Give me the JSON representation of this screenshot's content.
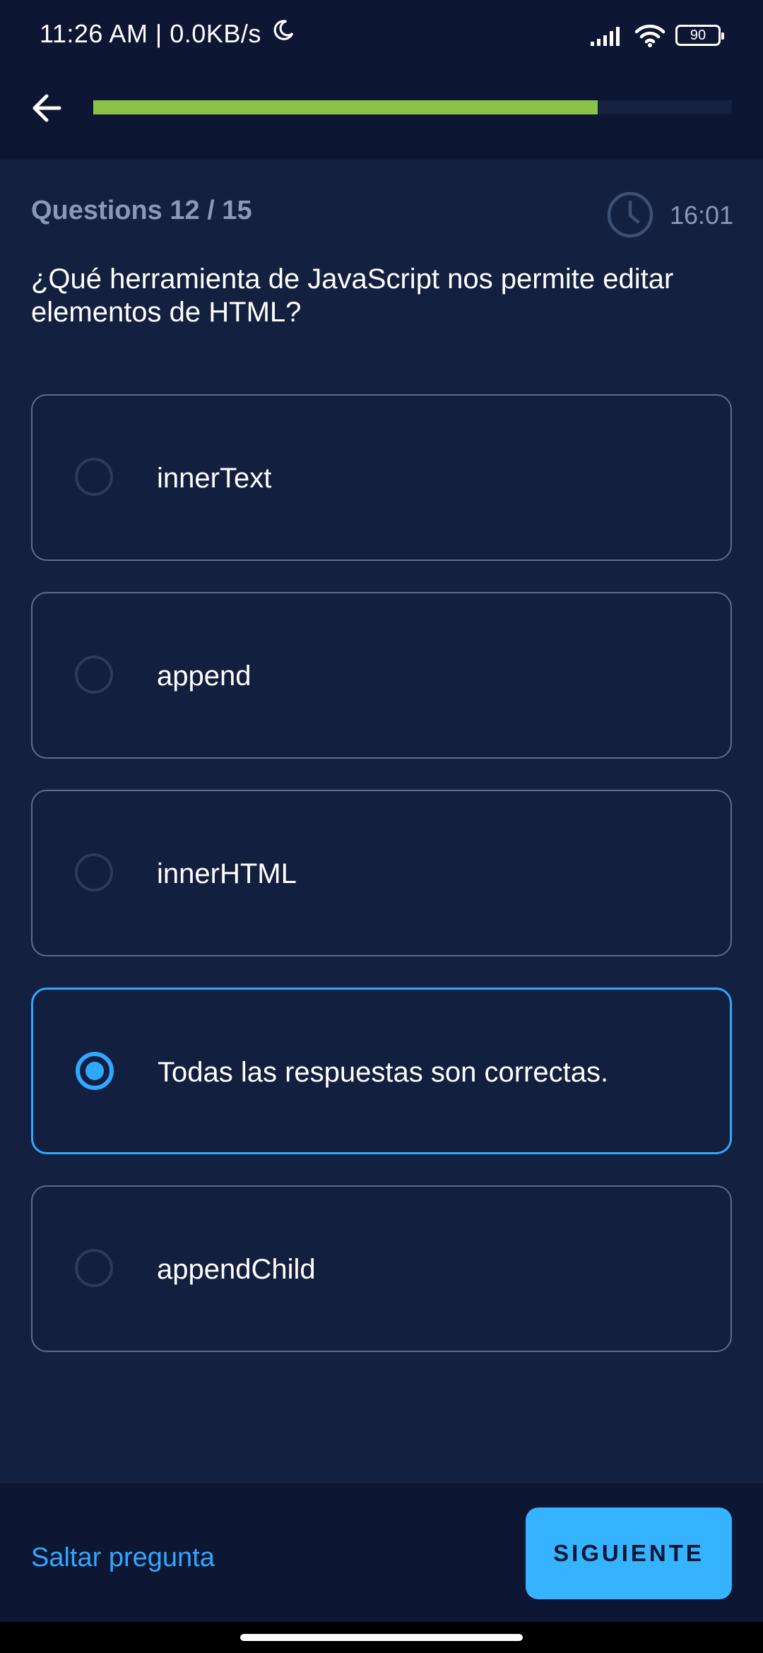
{
  "status_bar": {
    "time": "11:26 AM | 0.0KB/s",
    "battery": "90"
  },
  "progress": {
    "fraction": 0.79
  },
  "quiz": {
    "question_count": "Questions 12 / 15",
    "timer": "16:01",
    "question": "¿Qué herramienta de JavaScript nos permite editar elementos de HTML?",
    "options": [
      {
        "label": "innerText",
        "selected": false
      },
      {
        "label": "append",
        "selected": false
      },
      {
        "label": "innerHTML",
        "selected": false
      },
      {
        "label": "Todas las respuestas son correctas.",
        "selected": true
      },
      {
        "label": "appendChild",
        "selected": false
      }
    ]
  },
  "footer": {
    "skip_label": "Saltar pregunta",
    "next_label": "SIGUIENTE"
  },
  "colors": {
    "background": "#13203f",
    "bar_background": "#0d1633",
    "accent": "#2fa8ff",
    "progress": "#8bc34a",
    "muted_text": "#8a99b8"
  }
}
